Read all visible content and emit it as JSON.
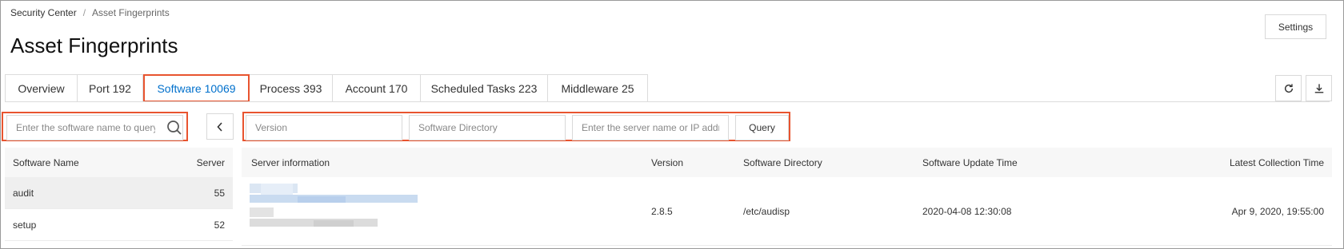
{
  "breadcrumb": {
    "parent": "Security Center",
    "separator": "/",
    "current": "Asset Fingerprints"
  },
  "page_title": "Asset Fingerprints",
  "header": {
    "settings_label": "Settings"
  },
  "tabs": [
    {
      "label": "Overview",
      "active": false
    },
    {
      "label": "Port 192",
      "active": false
    },
    {
      "label": "Software 10069",
      "active": true
    },
    {
      "label": "Process 393",
      "active": false
    },
    {
      "label": "Account 170",
      "active": false
    },
    {
      "label": "Scheduled Tasks 223",
      "active": false
    },
    {
      "label": "Middleware 25",
      "active": false
    }
  ],
  "toolbar": {
    "refresh_icon": "refresh-icon",
    "download_icon": "download-icon"
  },
  "software_search": {
    "placeholder": "Enter the software name to query",
    "value": ""
  },
  "filters": {
    "version_placeholder": "Version",
    "directory_placeholder": "Software Directory",
    "server_placeholder": "Enter the server name or IP address",
    "query_label": "Query"
  },
  "software_list": {
    "headers": {
      "name": "Software Name",
      "server": "Server"
    },
    "rows": [
      {
        "name": "audit",
        "server": "55",
        "selected": true
      },
      {
        "name": "setup",
        "server": "52",
        "selected": false
      }
    ]
  },
  "detail_table": {
    "headers": {
      "server_info": "Server information",
      "version": "Version",
      "directory": "Software Directory",
      "update_time": "Software Update Time",
      "collection_time": "Latest Collection Time"
    },
    "rows": [
      {
        "version": "2.8.5",
        "directory": "/etc/audisp",
        "update_time": "2020-04-08 12:30:08",
        "collection_time": "Apr 9, 2020, 19:55:00"
      }
    ]
  },
  "colors": {
    "accent": "#0070cc",
    "highlight": "#e8542f"
  }
}
